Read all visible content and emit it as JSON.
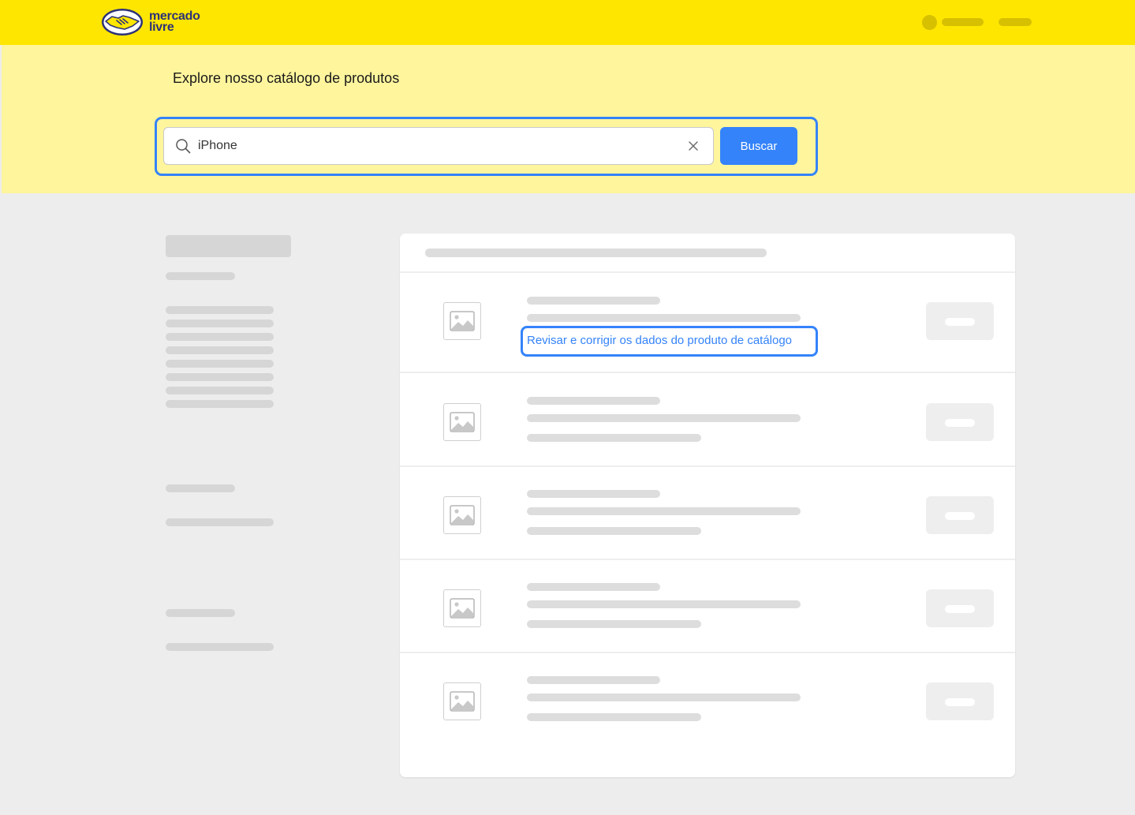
{
  "brand": {
    "name_line1": "mercado",
    "name_line2": "livre",
    "colors": {
      "brand_yellow": "#ffe600",
      "hero_yellow": "#fff59d",
      "accent_blue": "#3483fa",
      "logo_navy": "#2d3277"
    }
  },
  "hero": {
    "title": "Explore nosso catálogo de produtos"
  },
  "search": {
    "value": "iPhone",
    "button_label": "Buscar",
    "icons": {
      "search": "search-icon",
      "clear": "close-icon"
    }
  },
  "results": {
    "first_item_link": "Revisar e corrigir os dados do produto de catálogo",
    "item_count": 5
  }
}
